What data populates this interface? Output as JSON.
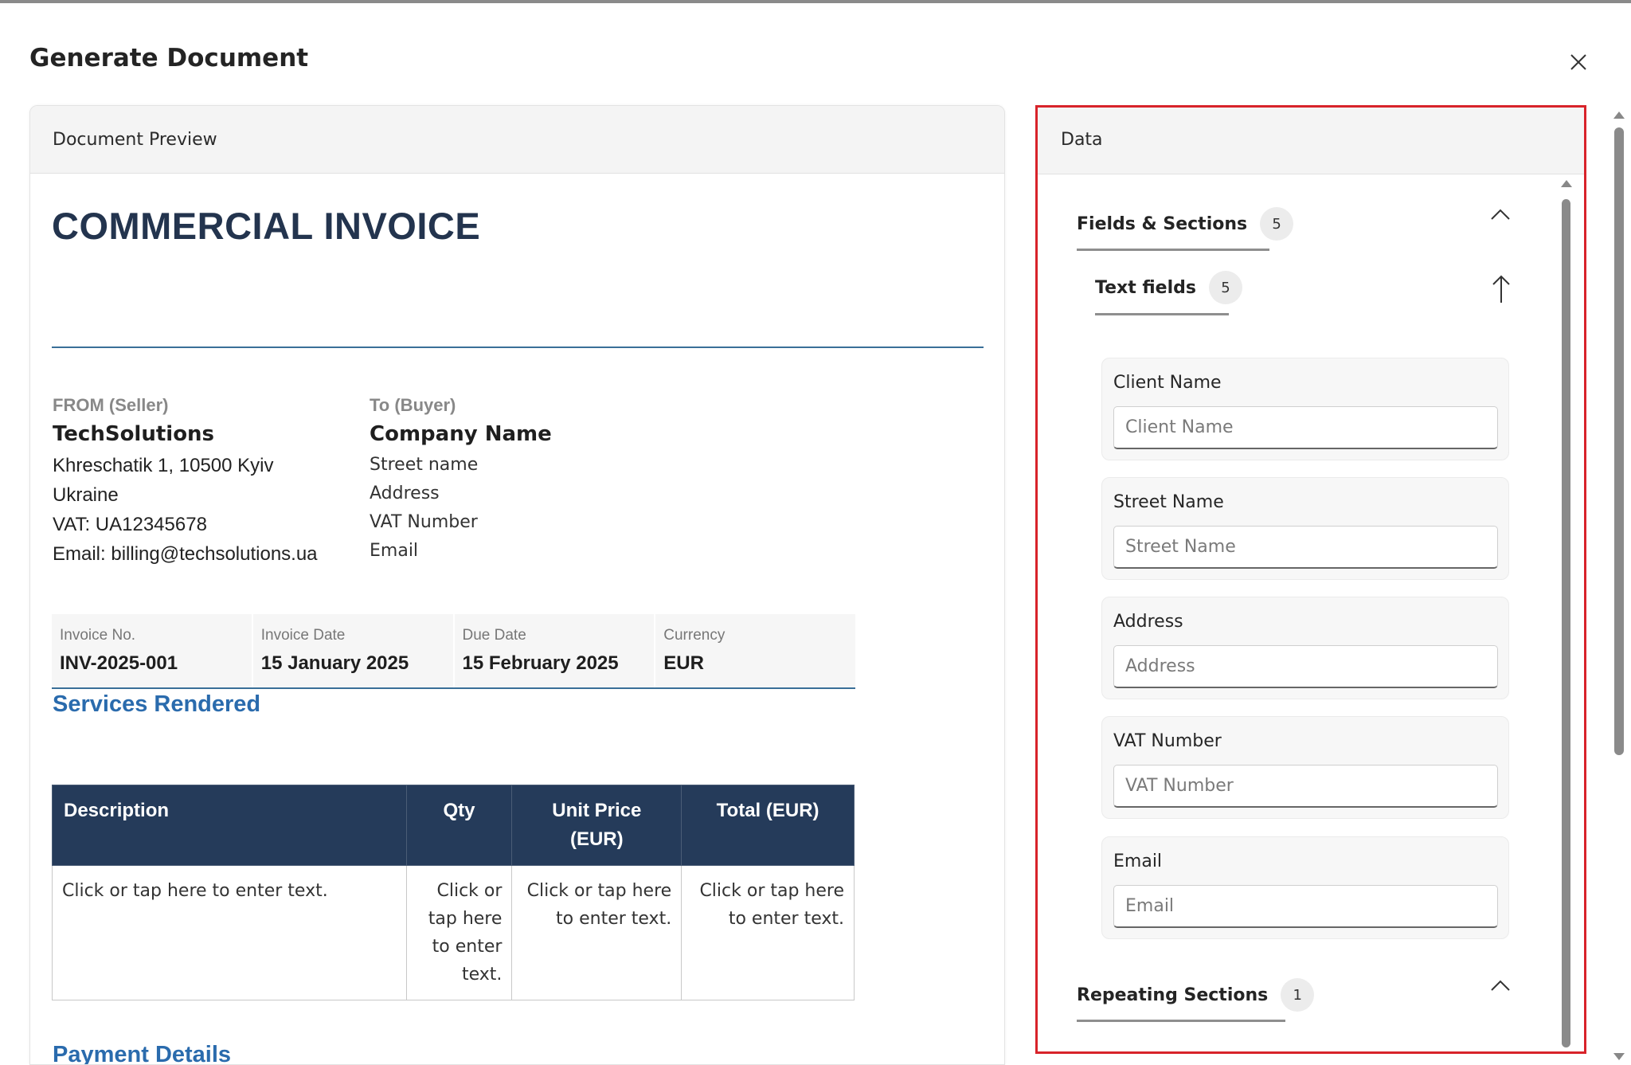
{
  "dialog": {
    "title": "Generate Document"
  },
  "preview": {
    "header": "Document Preview",
    "doc_title": "COMMERCIAL INVOICE",
    "seller": {
      "label": "FROM (Seller)",
      "name": "TechSolutions",
      "lines": [
        "Khreschatik 1, 10500 Kyiv",
        "Ukraine",
        "VAT: UA12345678",
        "Email: billing@techsolutions.ua"
      ]
    },
    "buyer": {
      "label": "To (Buyer)",
      "name": "Company Name",
      "lines": [
        "Street name",
        "Address",
        "VAT Number",
        "Email"
      ]
    },
    "meta": [
      {
        "key": "Invoice No.",
        "value": "INV-2025-001"
      },
      {
        "key": "Invoice Date",
        "value": "15 January 2025"
      },
      {
        "key": "Due Date",
        "value": "15 February 2025"
      },
      {
        "key": "Currency",
        "value": "EUR"
      }
    ],
    "services_heading": "Services Rendered",
    "table": {
      "headers": [
        "Description",
        "Qty",
        "Unit Price (EUR)",
        "Total (EUR)"
      ],
      "row": [
        "Click or tap here to enter text.",
        "Click or tap here to enter text.",
        "Click or tap here to enter text.",
        "Click or tap here to enter text."
      ]
    },
    "payment_heading": "Payment Details"
  },
  "data_panel": {
    "header": "Data",
    "fields_sections": {
      "label": "Fields & Sections",
      "count": "5"
    },
    "text_fields": {
      "label": "Text fields",
      "count": "5"
    },
    "fields": [
      {
        "label": "Client Name",
        "placeholder": "Client Name"
      },
      {
        "label": "Street Name",
        "placeholder": "Street Name"
      },
      {
        "label": "Address",
        "placeholder": "Address"
      },
      {
        "label": "VAT Number",
        "placeholder": "VAT Number"
      },
      {
        "label": "Email",
        "placeholder": "Email"
      }
    ],
    "repeating_sections": {
      "label": "Repeating Sections",
      "count": "1"
    }
  },
  "icons": {
    "close": "close-icon",
    "collapse": "chevron-up-icon",
    "sort": "arrow-up-icon"
  },
  "colors": {
    "title_navy": "#23344e",
    "accent_blue": "#2a6bad",
    "table_header": "#253b5a",
    "highlight_red": "#d8232a"
  }
}
